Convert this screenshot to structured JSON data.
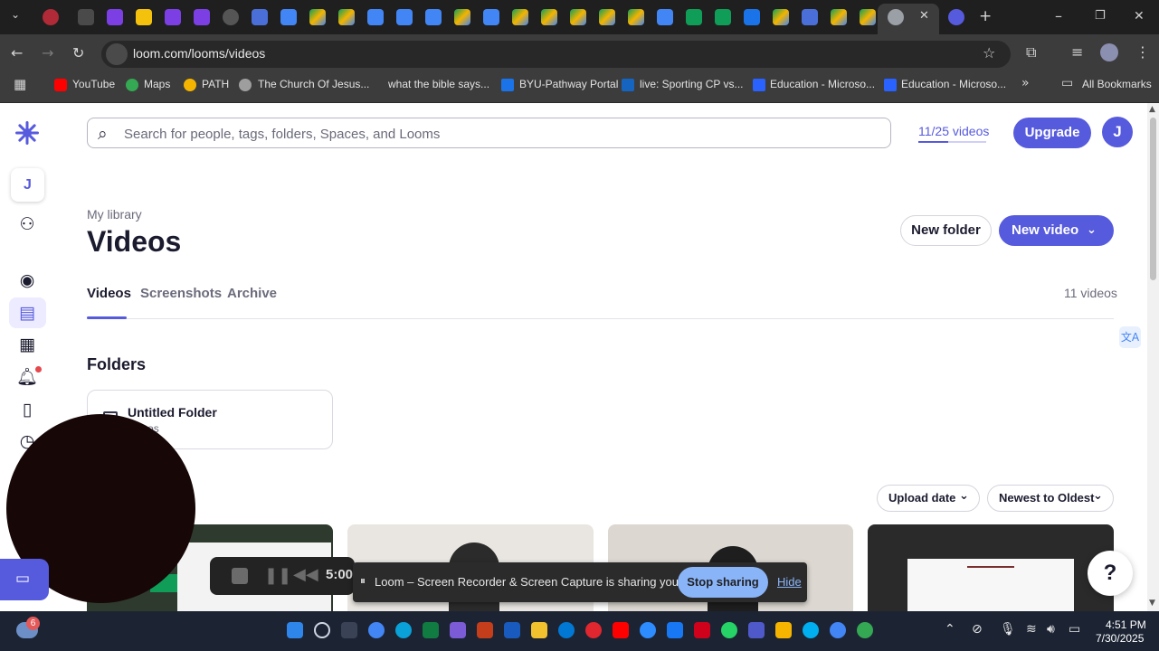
{
  "browser": {
    "url": "loom.com/looms/videos",
    "bookmarks": [
      {
        "label": "YouTube",
        "color": "#ff0000"
      },
      {
        "label": "Maps",
        "color": "#34a853"
      },
      {
        "label": "PATH",
        "color": "#f4b400"
      },
      {
        "label": "The Church Of Jesus...",
        "color": "#9e9e9e"
      },
      {
        "label": "what the bible says...",
        "color": "#3c3c3c"
      },
      {
        "label": "BYU-Pathway Portal",
        "color": "#1a73e8"
      },
      {
        "label": "live: Sporting CP vs...",
        "color": "#1565c0"
      },
      {
        "label": "Education - Microso...",
        "color": "#2962ff"
      },
      {
        "label": "Education - Microso...",
        "color": "#2962ff"
      }
    ],
    "all_bookmarks_label": "All Bookmarks"
  },
  "header": {
    "search_placeholder": "Search for people, tags, folders, Spaces, and Looms",
    "quota_label": "11/25 videos",
    "quota_fraction": 0.44,
    "upgrade_label": "Upgrade",
    "avatar_initial": "J"
  },
  "sidebar": {
    "workspace_initial": "J"
  },
  "library": {
    "breadcrumb": "My library",
    "title": "Videos",
    "new_folder_label": "New folder",
    "new_video_label": "New video",
    "tabs": [
      "Videos",
      "Screenshots",
      "Archive"
    ],
    "active_tab": "Videos",
    "video_count": "11 videos"
  },
  "folders": {
    "heading": "Folders",
    "items": [
      {
        "name": "Untitled Folder",
        "sub": "videos"
      }
    ]
  },
  "sort": {
    "by_label": "Upload date",
    "order_label": "Newest to Oldest"
  },
  "recording": {
    "timer": "5:00",
    "share_message": "Loom – Screen Recorder & Screen Capture is sharing your screen.",
    "stop_label": "Stop sharing",
    "hide_label": "Hide"
  },
  "taskbar": {
    "time": "4:51 PM",
    "date": "7/30/2025",
    "notification_badge": "6"
  },
  "colors": {
    "brand": "#565ADD",
    "text": "#1b1b2f",
    "muted": "#6b6b7b"
  }
}
